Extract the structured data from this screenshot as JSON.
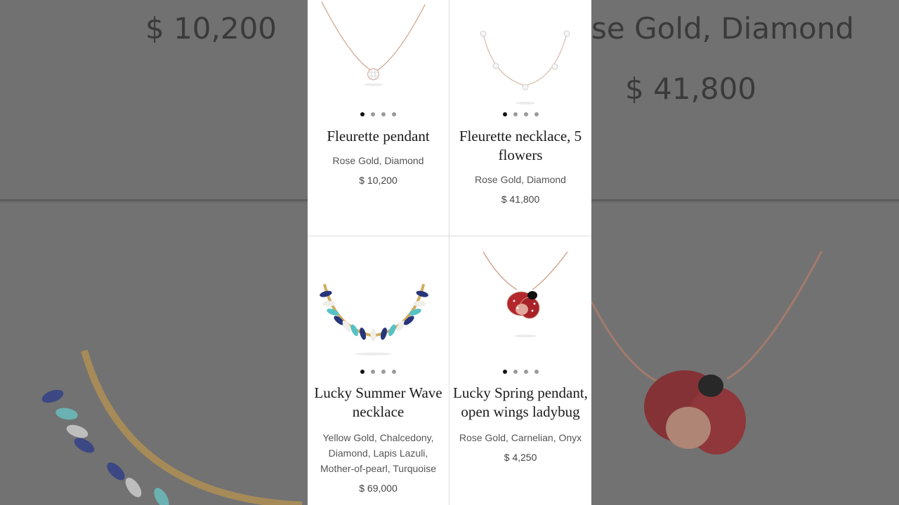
{
  "background": {
    "price_left": "$ 10,200",
    "material_right": "se Gold, Diamond",
    "price_right": "$ 41,800"
  },
  "products": [
    {
      "name": "Fleurette pendant",
      "material": "Rose Gold, Diamond",
      "price": "$ 10,200",
      "icon": "necklace-pendant-icon",
      "carousel_dots": 4,
      "active_dot": 0
    },
    {
      "name": "Fleurette necklace, 5 flowers",
      "material": "Rose Gold, Diamond",
      "price": "$ 41,800",
      "icon": "necklace-five-flowers-icon",
      "carousel_dots": 4,
      "active_dot": 0
    },
    {
      "name": "Lucky Summer Wave necklace",
      "material": "Yellow Gold, Chalcedony, Diamond, Lapis Lazuli, Mother-of-pearl, Turquoise",
      "price": "$ 69,000",
      "icon": "wave-necklace-icon",
      "carousel_dots": 4,
      "active_dot": 0
    },
    {
      "name": "Lucky Spring pendant, open wings ladybug",
      "material": "Rose Gold, Carnelian, Onyx",
      "price": "$ 4,250",
      "icon": "ladybug-pendant-icon",
      "carousel_dots": 4,
      "active_dot": 0
    }
  ],
  "colors": {
    "rose_gold": "#d9a88f",
    "carnelian": "#b3262b",
    "onyx": "#111111",
    "lapis": "#27357a",
    "turquoise": "#56c2c6",
    "yellow_gold": "#d8b56a"
  }
}
